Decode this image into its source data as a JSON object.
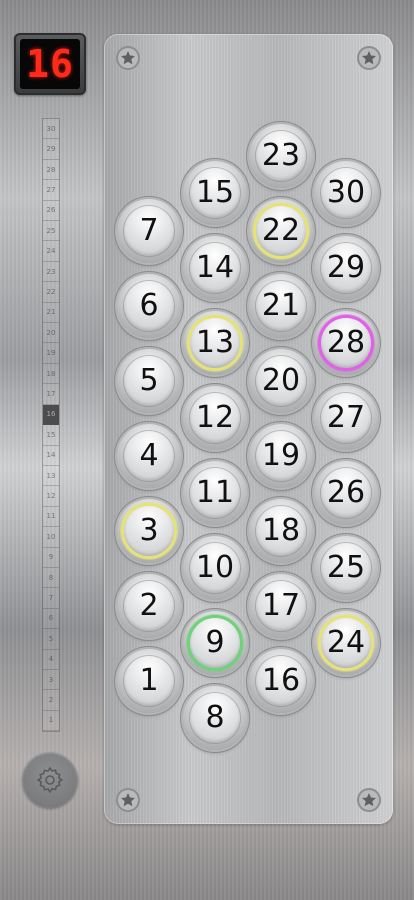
{
  "display": {
    "floor": "16"
  },
  "indicator": {
    "floors": [
      "30",
      "29",
      "28",
      "27",
      "26",
      "25",
      "24",
      "23",
      "22",
      "21",
      "20",
      "19",
      "18",
      "17",
      "16",
      "15",
      "14",
      "13",
      "12",
      "11",
      "10",
      "9",
      "8",
      "7",
      "6",
      "5",
      "4",
      "3",
      "2",
      "1"
    ],
    "active": "16"
  },
  "settings": {
    "icon": "gear-icon"
  },
  "colors": {
    "yellow_ring": "#e6e27a",
    "green_ring": "#6fd27a",
    "magenta_ring": "#e060e8",
    "display_red": "#ff2a1a"
  },
  "buttons": {
    "b1": {
      "label": "1"
    },
    "b2": {
      "label": "2"
    },
    "b3": {
      "label": "3"
    },
    "b4": {
      "label": "4"
    },
    "b5": {
      "label": "5"
    },
    "b6": {
      "label": "6"
    },
    "b7": {
      "label": "7"
    },
    "b8": {
      "label": "8"
    },
    "b9": {
      "label": "9"
    },
    "b10": {
      "label": "10"
    },
    "b11": {
      "label": "11"
    },
    "b12": {
      "label": "12"
    },
    "b13": {
      "label": "13"
    },
    "b14": {
      "label": "14"
    },
    "b15": {
      "label": "15"
    },
    "b16": {
      "label": "16"
    },
    "b17": {
      "label": "17"
    },
    "b18": {
      "label": "18"
    },
    "b19": {
      "label": "19"
    },
    "b20": {
      "label": "20"
    },
    "b21": {
      "label": "21"
    },
    "b22": {
      "label": "22"
    },
    "b23": {
      "label": "23"
    },
    "b24": {
      "label": "24"
    },
    "b25": {
      "label": "25"
    },
    "b26": {
      "label": "26"
    },
    "b27": {
      "label": "27"
    },
    "b28": {
      "label": "28"
    },
    "b29": {
      "label": "29"
    },
    "b30": {
      "label": "30"
    }
  }
}
